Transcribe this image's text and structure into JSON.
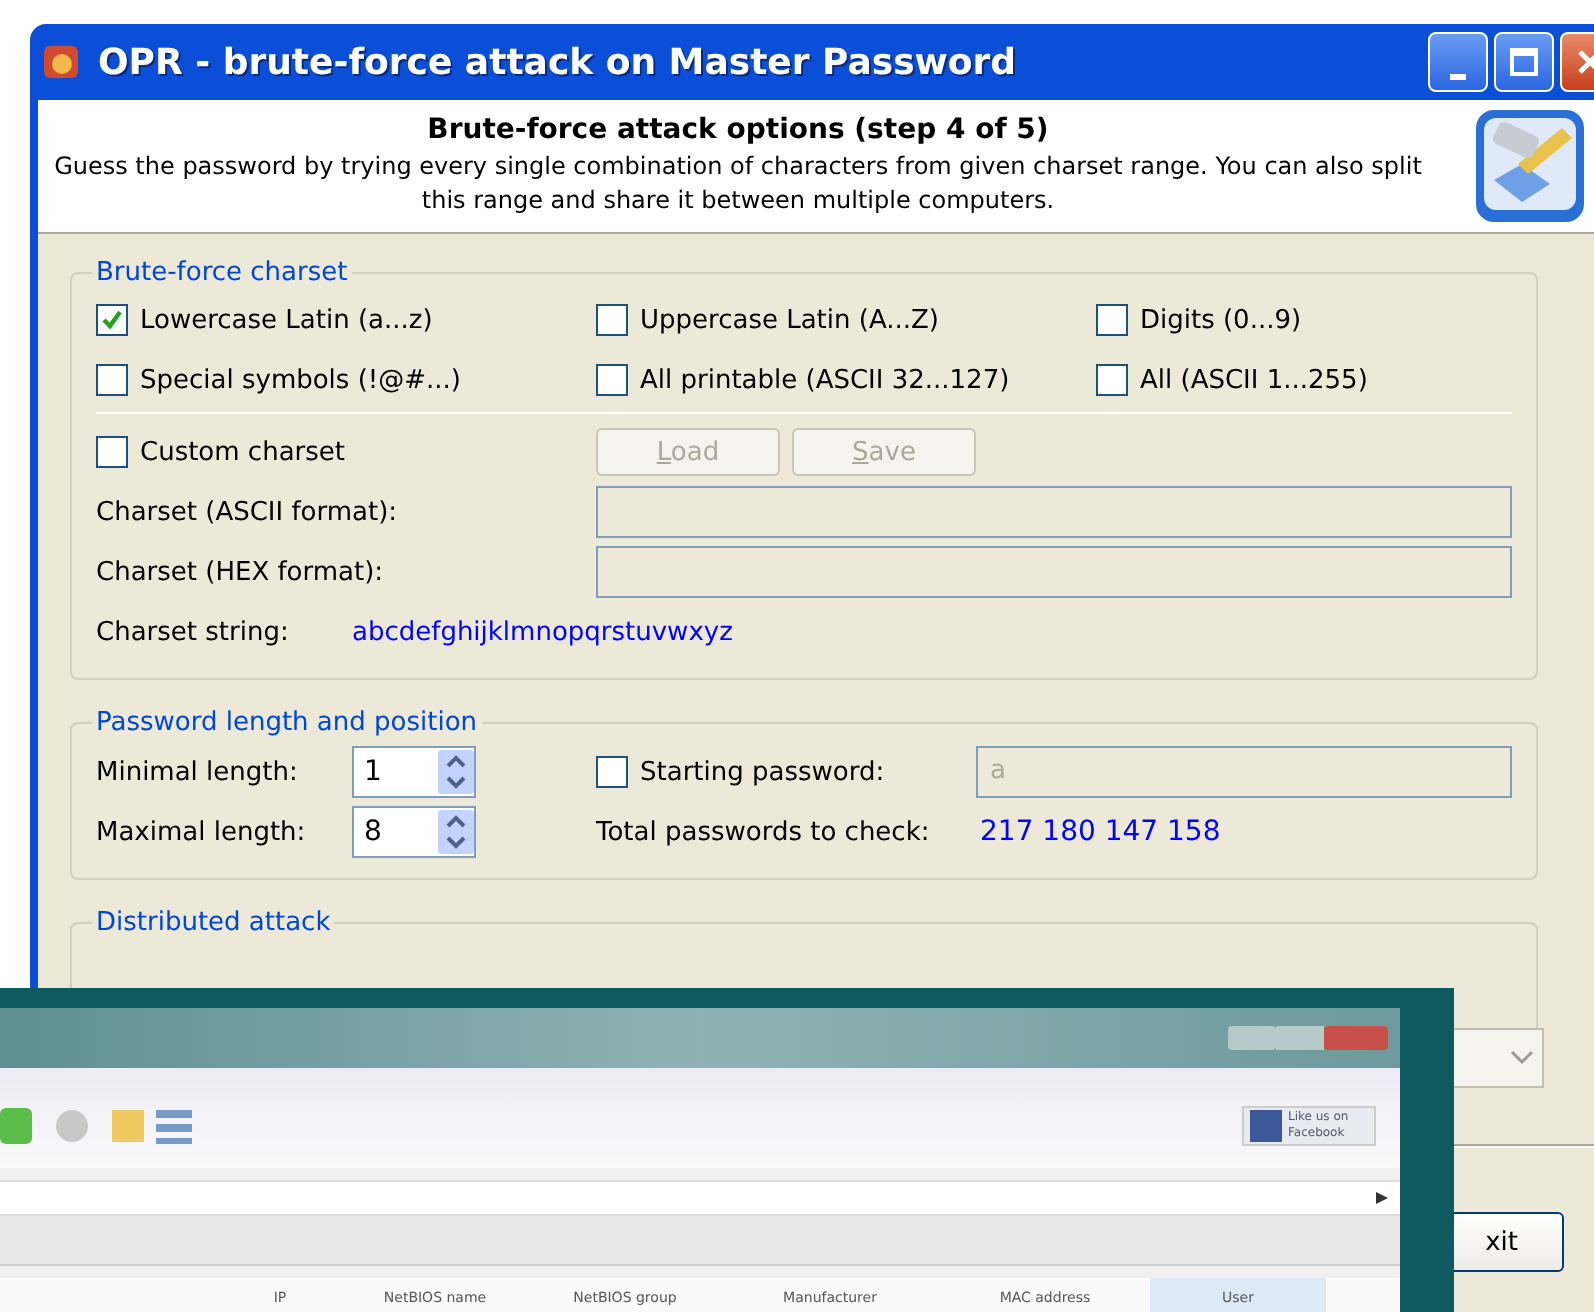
{
  "window": {
    "title": "OPR - brute-force attack on Master Password"
  },
  "header": {
    "title": "Brute-force attack options (step 4 of 5)",
    "description": "Guess the password by trying every single combination of characters from given charset range. You can also split this range and share it between multiple computers."
  },
  "charset": {
    "legend": "Brute-force charset",
    "options": [
      {
        "label": "Lowercase Latin (a...z)",
        "checked": true
      },
      {
        "label": "Uppercase Latin (A...Z)",
        "checked": false
      },
      {
        "label": "Digits (0...9)",
        "checked": false
      },
      {
        "label": "Special symbols (!@#...)",
        "checked": false
      },
      {
        "label": "All printable (ASCII 32...127)",
        "checked": false
      },
      {
        "label": "All (ASCII 1...255)",
        "checked": false
      }
    ],
    "custom": {
      "label": "Custom charset",
      "checked": false
    },
    "buttons": [
      {
        "label": "Load",
        "disabled": true
      },
      {
        "label": "Save",
        "disabled": true
      }
    ],
    "ascii_label": "Charset (ASCII format):",
    "hex_label": "Charset (HEX format):",
    "string_label": "Charset string:",
    "string_value": "abcdefghijklmnopqrstuvwxyz"
  },
  "length": {
    "legend": "Password length and position",
    "min_label": "Minimal length:",
    "min_value": "1",
    "max_label": "Maximal length:",
    "max_value": "8",
    "start": {
      "label": "Starting password:",
      "checked": false,
      "value": "a"
    },
    "total_label": "Total passwords to check:",
    "total_value": "217 180 147 158"
  },
  "distributed": {
    "legend": "Distributed attack"
  },
  "exit_button": "xit",
  "overlay": {
    "facebook": "Like us on Facebook",
    "columns": [
      "IP",
      "NetBIOS name",
      "NetBIOS group",
      "Manufacturer",
      "MAC address",
      "User"
    ]
  }
}
